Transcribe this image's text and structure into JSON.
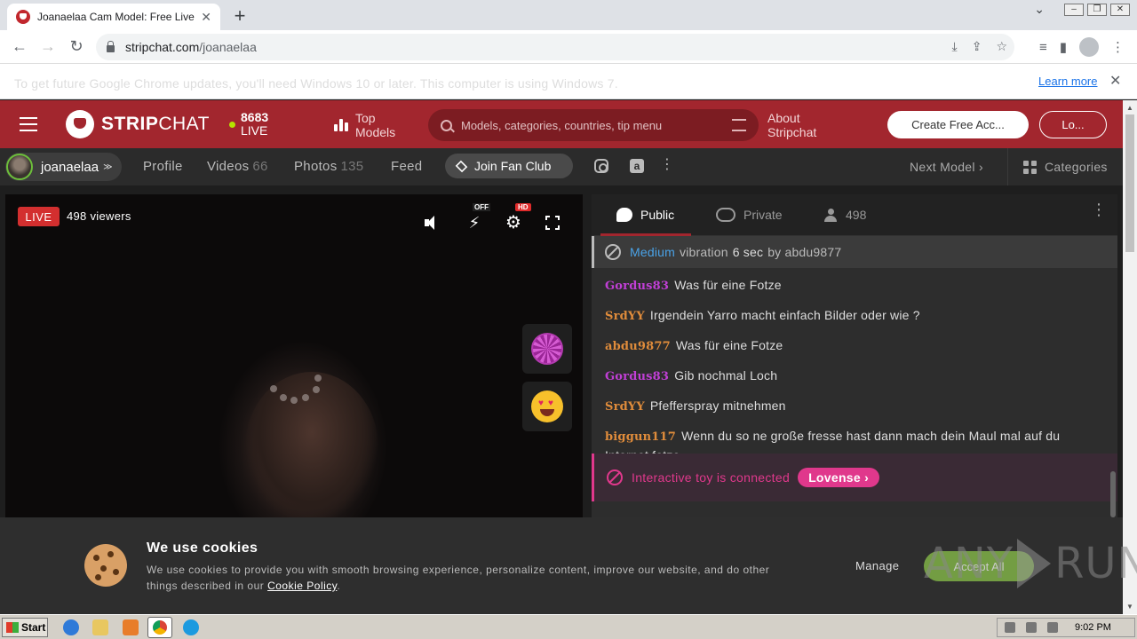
{
  "browser": {
    "tab_title": "Joanaelaa Cam Model: Free Live Sex",
    "tab_close": "✕",
    "new_tab": "+",
    "url_host": "stripchat.com",
    "url_path": "/joanaelaa",
    "back": "←",
    "forward": "→",
    "reload": "↻"
  },
  "infobar": {
    "message": "To get future Google Chrome updates, you'll need Windows 10 or later. This computer is using Windows 7.",
    "link": "Learn more",
    "close": "✕"
  },
  "header": {
    "logo_bold": "STRIP",
    "logo_thin": "CHAT",
    "live_count": "8683",
    "live_label": "LIVE",
    "top_models_1": "Top",
    "top_models_2": "Models",
    "search_placeholder": "Models, categories, countries, tip menu",
    "about_1": "About",
    "about_2": "Stripchat",
    "create_account": "Create Free Acc...",
    "login": "Lo..."
  },
  "modelbar": {
    "username": "joanaelaa",
    "chevron": "≫",
    "profile": "Profile",
    "videos": "Videos",
    "videos_count": "66",
    "photos": "Photos",
    "photos_count": "135",
    "feed": "Feed",
    "fan_club": "Join Fan Club",
    "amazon": "a",
    "kebab": "⋮",
    "next_model": "Next Model",
    "next_chevron": "›",
    "categories": "Categories"
  },
  "video": {
    "live_badge": "LIVE",
    "viewers": "498 viewers",
    "bolt": "⚡",
    "off_tag": "OFF",
    "gear": "⚙",
    "hd_tag": "HD",
    "heart_eyes": "♥"
  },
  "chat": {
    "tab_public": "Public",
    "tab_private": "Private",
    "user_count": "498",
    "kebab": "⋮",
    "vibration": {
      "level": "Medium",
      "text": "vibration",
      "time": "6 sec",
      "by": "by abdu9877"
    },
    "messages": [
      {
        "user": "Gordus83",
        "text": "Was für eine Fotze",
        "color": "#c13fd6"
      },
      {
        "user": "SrdYY",
        "text": "Irgendein Yarro macht einfach Bilder oder wie ?",
        "color": "#e08c3b"
      },
      {
        "user": "abdu9877",
        "text": "Was für eine Fotze",
        "color": "#e08c3b"
      },
      {
        "user": "Gordus83",
        "text": "Gib nochmal Loch",
        "color": "#c13fd6"
      },
      {
        "user": "SrdYY",
        "text": "Pfefferspray mitnehmen",
        "color": "#e08c3b"
      },
      {
        "user": "biggun117",
        "text": "Wenn du so ne große fresse hast dann mach dein Maul mal auf du Internet fotze",
        "color": "#e08c3b"
      }
    ],
    "toy_text": "Interactive toy is connected",
    "toy_button": "Lovense ›"
  },
  "cookie": {
    "title": "We use cookies",
    "text": "We use cookies to provide you with smooth browsing experience, personalize content, improve our website, and do other things described in our",
    "policy_link": "Cookie Policy",
    "period": ".",
    "manage": "Manage",
    "accept": "Accept All"
  },
  "watermark": {
    "any": "ANY",
    "run": "RUN"
  },
  "taskbar": {
    "start": "Start",
    "time": "9:02 PM"
  }
}
